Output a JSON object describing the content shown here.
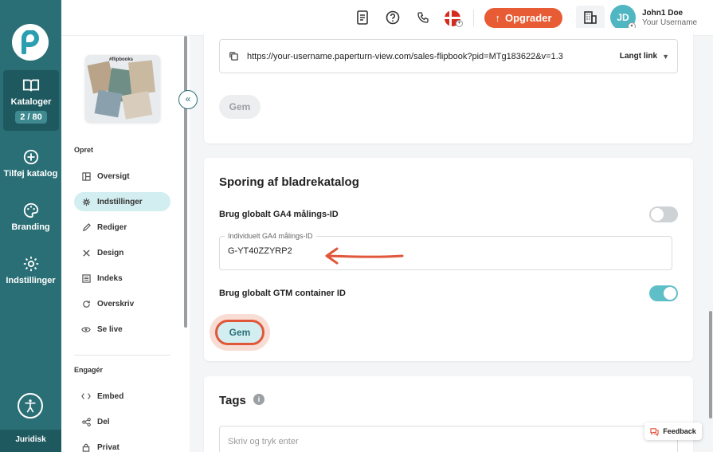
{
  "rail": {
    "items": [
      {
        "label": "Kataloger",
        "icon": "book-open-icon",
        "badge": "2 / 80"
      },
      {
        "label": "Tilføj katalog",
        "icon": "plus-circle-icon"
      },
      {
        "label": "Branding",
        "icon": "palette-icon"
      },
      {
        "label": "Indstillinger",
        "icon": "gear-icon"
      }
    ],
    "legal": "Juridisk"
  },
  "header": {
    "upgrade_label": "Opgrader",
    "avatar_initials": "JD",
    "user_name": "John1 Doe",
    "user_sub": "Your Username"
  },
  "subnav": {
    "thumb_label": "#flipbooks",
    "collapse_glyph": "«",
    "group1": "Opret",
    "group2": "Engagér",
    "items": [
      {
        "label": "Oversigt"
      },
      {
        "label": "Indstillinger"
      },
      {
        "label": "Rediger"
      },
      {
        "label": "Design"
      },
      {
        "label": "Indeks"
      },
      {
        "label": "Overskriv"
      },
      {
        "label": "Se live"
      },
      {
        "label": "Embed"
      },
      {
        "label": "Del"
      },
      {
        "label": "Privat"
      }
    ]
  },
  "link_card": {
    "url": "https://your-username.paperturn-view.com/sales-flipbook?pid=MTg183622&v=1.3",
    "mode": "Langt link",
    "save_label": "Gem"
  },
  "tracking": {
    "title": "Sporing af bladrekatalog",
    "ga4_global_label": "Brug globalt GA4 målings-ID",
    "ga4_global_on": false,
    "ga4_field_legend": "Individuelt GA4 målings-ID",
    "ga4_field_value": "G-YT40ZZYRP2",
    "gtm_global_label": "Brug globalt GTM container ID",
    "gtm_global_on": true,
    "save_label": "Gem"
  },
  "tags": {
    "title": "Tags",
    "info_glyph": "i",
    "placeholder": "Skriv og tryk enter"
  },
  "feedback_label": "Feedback",
  "colors": {
    "rail": "#2b6f76",
    "accent_orange": "#e85c35",
    "toggle_on": "#5fbfc8"
  }
}
